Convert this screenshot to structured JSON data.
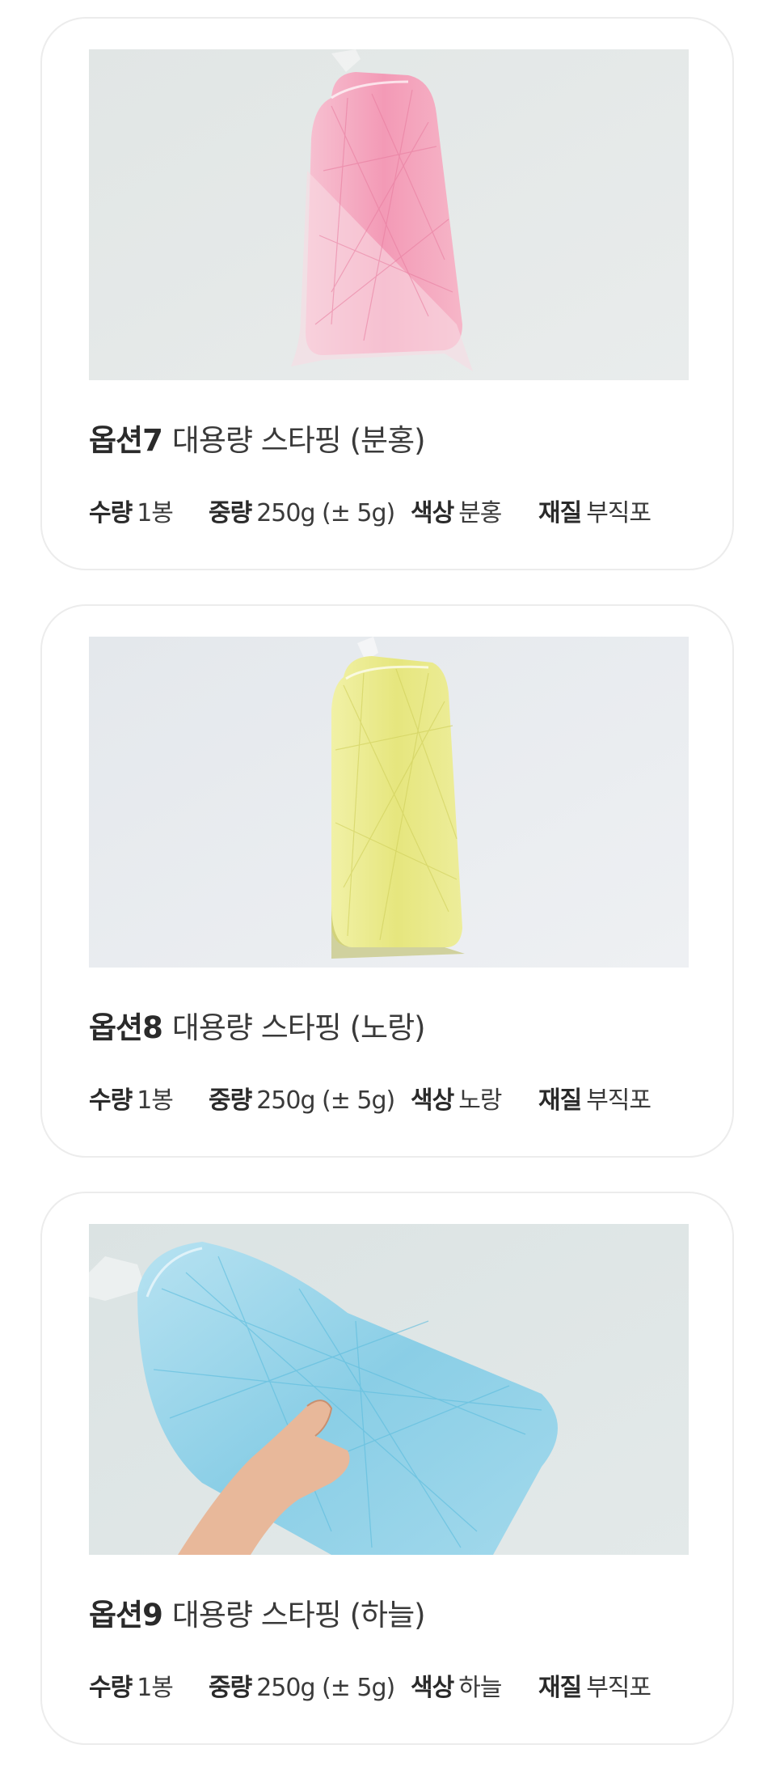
{
  "options": [
    {
      "option_label": "옵션7",
      "product_name": "대용량 스타핑 (분홍)",
      "specs": [
        {
          "key": "수량",
          "value": "1봉"
        },
        {
          "key": "중량",
          "value": "250g (± 5g)"
        },
        {
          "key": "색상",
          "value": "분홍"
        },
        {
          "key": "재질",
          "value": "부직포"
        }
      ]
    },
    {
      "option_label": "옵션8",
      "product_name": "대용량 스타핑 (노랑)",
      "specs": [
        {
          "key": "수량",
          "value": "1봉"
        },
        {
          "key": "중량",
          "value": "250g (± 5g)"
        },
        {
          "key": "색상",
          "value": "노랑"
        },
        {
          "key": "재질",
          "value": "부직포"
        }
      ]
    },
    {
      "option_label": "옵션9",
      "product_name": "대용량 스타핑 (하늘)",
      "specs": [
        {
          "key": "수량",
          "value": "1봉"
        },
        {
          "key": "중량",
          "value": "250g (± 5g)"
        },
        {
          "key": "색상",
          "value": "하늘"
        },
        {
          "key": "재질",
          "value": "부직포"
        }
      ]
    }
  ],
  "colors": {
    "card_border": "#ececec",
    "photo_bg_pink": "#e4e8e7",
    "photo_bg_yellow": "#e8ebee",
    "photo_bg_blue": "#dde4e4",
    "pink_stuffing": "#f4a3bb",
    "yellow_stuffing": "#eaea8c",
    "blue_stuffing": "#8fd2ea"
  }
}
